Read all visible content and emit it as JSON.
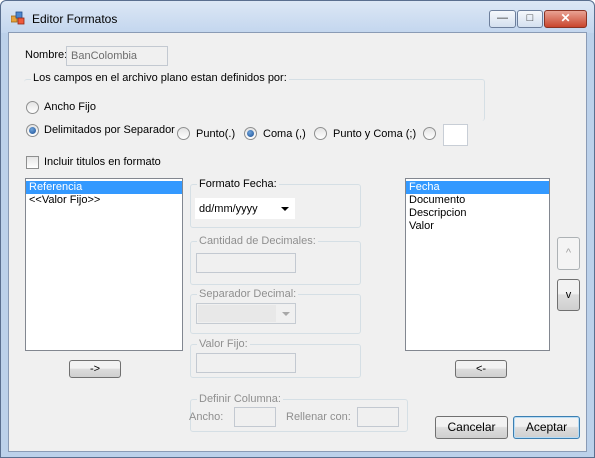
{
  "window": {
    "title": "Editor Formatos",
    "minimize_glyph": "—",
    "maximize_glyph": "□",
    "close_glyph": "✕"
  },
  "nombre": {
    "label": "Nombre:",
    "value": "BanColombia"
  },
  "campos_group": {
    "title": "Los campos en el archivo plano estan definidos por:"
  },
  "ancho_fijo": {
    "label": "Ancho Fijo",
    "checked": false
  },
  "delimitados": {
    "label": "Delimitados por Separador",
    "checked": true
  },
  "separators": {
    "punto": {
      "label": "Punto(.)",
      "checked": false
    },
    "coma": {
      "label": "Coma (,)",
      "checked": true
    },
    "punto_coma": {
      "label": "Punto y Coma (;)",
      "checked": false
    },
    "otro": {
      "checked": false,
      "value": ""
    }
  },
  "incluir_titulos": {
    "label": "Incluir titulos en formato",
    "checked": false
  },
  "left_list": {
    "items": [
      "Referencia",
      "<<Valor Fijo>>"
    ],
    "selected_index": 0
  },
  "move_right_button": "->",
  "formato_fecha": {
    "title": "Formato Fecha:",
    "value": "dd/mm/yyyy"
  },
  "cantidad_decimales": {
    "title": "Cantidad de Decimales:",
    "value": ""
  },
  "separador_decimal": {
    "title": "Separador Decimal:",
    "value": ""
  },
  "valor_fijo": {
    "title": "Valor Fijo:",
    "value": ""
  },
  "definir_columna": {
    "title": "Definir Columna:",
    "ancho_label": "Ancho:",
    "ancho_value": "",
    "rellenar_label": "Rellenar con:",
    "rellenar_value": ""
  },
  "right_list": {
    "items": [
      "Fecha",
      "Documento",
      "Descripcion",
      "Valor"
    ],
    "selected_index": 0
  },
  "move_left_button": "<-",
  "up_button": "^",
  "down_button": "v",
  "cancelar_button": "Cancelar",
  "aceptar_button": "Aceptar"
}
